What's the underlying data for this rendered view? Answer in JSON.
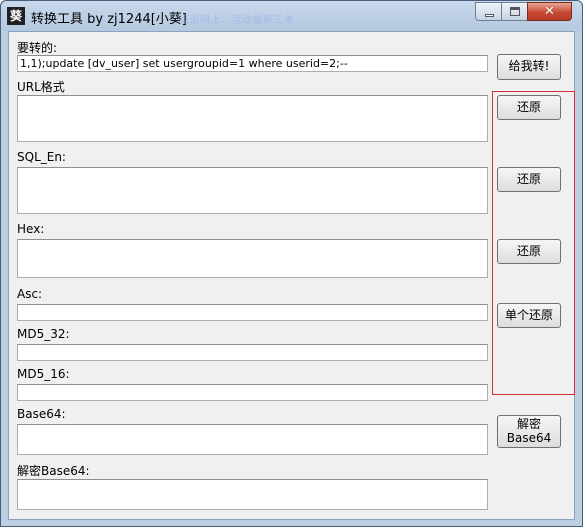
{
  "window": {
    "title": "转换工具 by zj1244[小葵]",
    "icon_char": "葵",
    "ghost_text": "点击网上、活动最新工单",
    "controls": {
      "minimize": "minimize-icon",
      "maximize": "maximize-icon",
      "close": "close-icon"
    }
  },
  "input": {
    "label": "要转的:",
    "value": "1,1);update [dv_user] set usergroupid=1 where userid=2;--",
    "convert_label": "给我转!"
  },
  "url": {
    "label": "URL格式",
    "value": "",
    "restore_label": "还原"
  },
  "sql": {
    "label": "SQL_En:",
    "value": "",
    "restore_label": "还原"
  },
  "hex": {
    "label": "Hex:",
    "value": "",
    "restore_label": "还原"
  },
  "asc": {
    "label": "Asc:",
    "value": "",
    "restore_label": "单个还原"
  },
  "md5_32": {
    "label": "MD5_32:",
    "value": ""
  },
  "md5_16": {
    "label": "MD5_16:",
    "value": ""
  },
  "base64": {
    "label": "Base64:",
    "value": "",
    "decode_line1": "解密",
    "decode_line2": "Base64"
  },
  "decoded_base64": {
    "label": "解密Base64:",
    "value": ""
  },
  "colors": {
    "title_bg": "#bfcfe2",
    "close_red": "#c74a35",
    "group_border": "#d23030",
    "client_bg": "#f0f0f0"
  }
}
